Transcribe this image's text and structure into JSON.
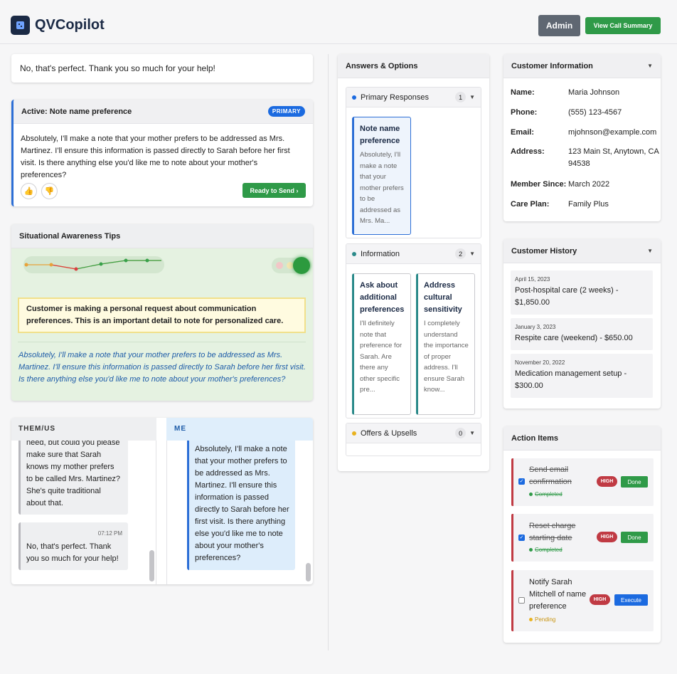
{
  "header": {
    "logo_icon": "app-logo-icon",
    "app_name": "QVCopilot",
    "admin_label": "Admin",
    "summary_label": "View Call Summary"
  },
  "last_message": "No, that's perfect. Thank you so much for your help!",
  "active": {
    "title": "Active: Note name preference",
    "badge": "PRIMARY",
    "body": "Absolutely, I'll make a note that your mother prefers to be addressed as Mrs. Martinez. I'll ensure this information is passed directly to Sarah before her first visit. Is there anything else you'd like me to note about your mother's preferences?",
    "thumbs_up": "👍",
    "thumbs_down": "👎",
    "ready_label": "Ready to Send ›"
  },
  "tips": {
    "title": "Situational Awareness Tips",
    "alert": "Customer is making a personal request about communication preferences. This is an important detail to note for personalized care.",
    "quote": "Absolutely, I'll make a note that your mother prefers to be addressed as Mrs. Martinez. I'll ensure this information is passed directly to Sarah before her first visit. Is there anything else you'd like me to note about your mother's preferences?"
  },
  "chat": {
    "them_label": "THEM/US",
    "me_label": "ME",
    "them_msg1": "need, but could you please make sure that Sarah knows my mother prefers to be called Mrs. Martinez? She's quite traditional about that.",
    "them_msg2_time": "07:12 PM",
    "them_msg2": "No, that's perfect. Thank you so much for your help!",
    "me_msg": "Absolutely, I'll make a note that your mother prefers to be addressed as Mrs. Martinez. I'll ensure this information is passed directly to Sarah before her first visit. Is there anything else you'd like me to note about your mother's preferences?"
  },
  "answers": {
    "title": "Answers & Options",
    "sections": [
      {
        "label": "Primary Responses",
        "count": "1",
        "color": "#1b6ae0",
        "options": [
          {
            "title": "Note name preference",
            "text": "Absolutely, I'll make a note that your mother prefers to be addressed as Mrs. Ma..."
          }
        ]
      },
      {
        "label": "Information",
        "count": "2",
        "color": "#2b8a8a",
        "options": [
          {
            "title": "Ask about additional preferences",
            "text": "I'll definitely note that preference for Sarah. Are there any other specific pre..."
          },
          {
            "title": "Address cultural sensitivity",
            "text": "I completely understand the importance of proper address. I'll ensure Sarah know..."
          }
        ]
      },
      {
        "label": "Offers & Upsells",
        "count": "0",
        "color": "#e9b21f",
        "options": []
      }
    ]
  },
  "customer": {
    "title": "Customer Information",
    "rows": [
      {
        "label": "Name:",
        "value": "Maria Johnson"
      },
      {
        "label": "Phone:",
        "value": "(555) 123-4567"
      },
      {
        "label": "Email:",
        "value": "mjohnson@example.com"
      },
      {
        "label": "Address:",
        "value": "123 Main St, Anytown, CA 94538"
      },
      {
        "label": "Member Since:",
        "value": "March 2022"
      },
      {
        "label": "Care Plan:",
        "value": "Family Plus"
      }
    ]
  },
  "history": {
    "title": "Customer History",
    "items": [
      {
        "date": "April 15, 2023",
        "text": "Post-hospital care (2 weeks) - $1,850.00"
      },
      {
        "date": "January 3, 2023",
        "text": "Respite care (weekend) - $650.00"
      },
      {
        "date": "November 20, 2022",
        "text": "Medication management setup - $300.00"
      }
    ]
  },
  "actions": {
    "title": "Action Items",
    "items": [
      {
        "text": "Send email confirmation",
        "status": "Completed",
        "priority": "HIGH",
        "button": "Done",
        "checked": true
      },
      {
        "text": "Reset charge starting date",
        "status": "Completed",
        "priority": "HIGH",
        "button": "Done",
        "checked": true
      },
      {
        "text": "Notify Sarah Mitchell of name preference",
        "status": "Pending",
        "priority": "HIGH",
        "button": "Execute",
        "checked": false
      }
    ]
  }
}
